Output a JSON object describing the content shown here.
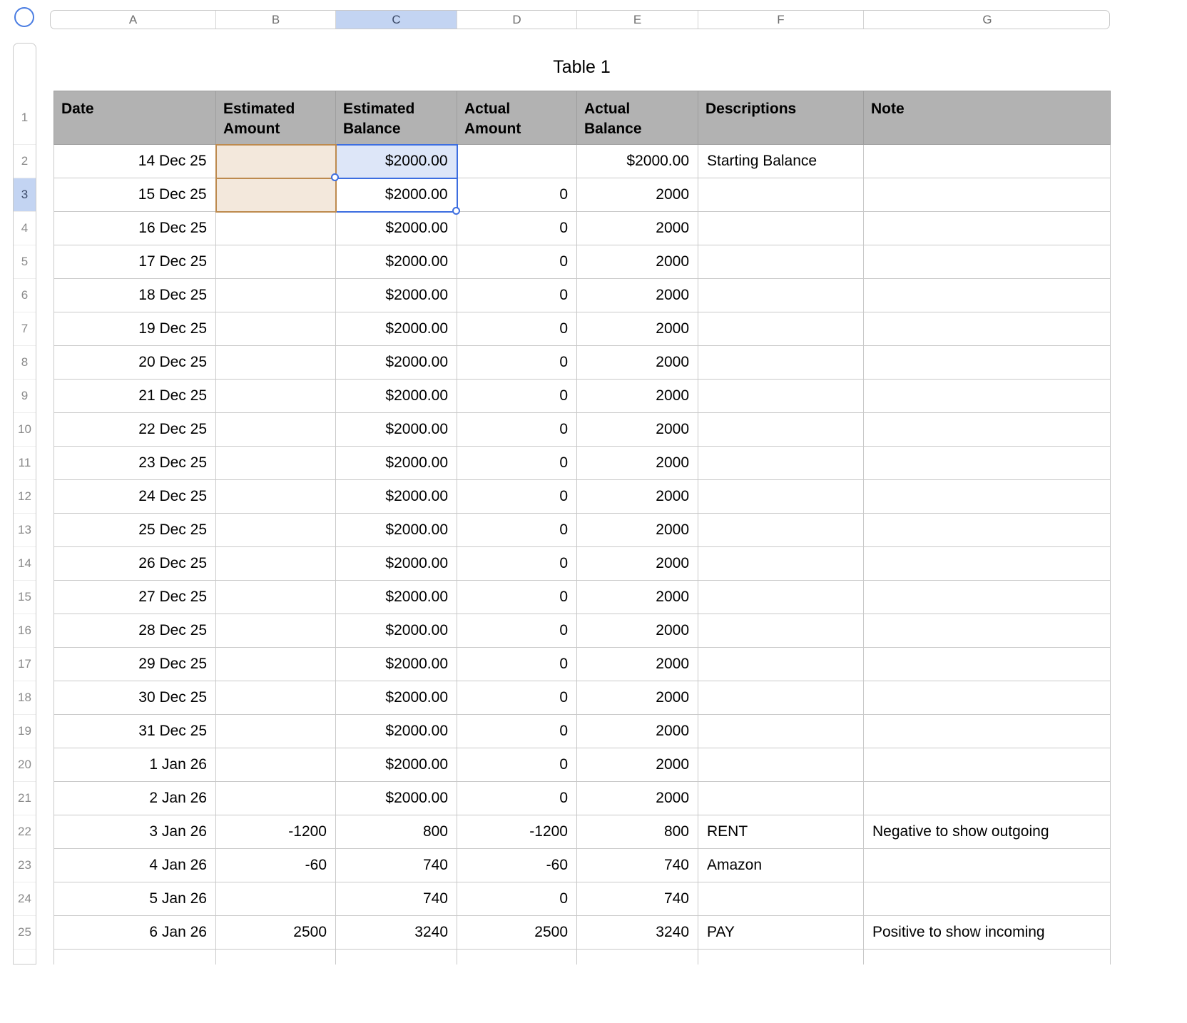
{
  "title": "Table 1",
  "column_strip": {
    "letters": [
      "A",
      "B",
      "C",
      "D",
      "E",
      "F",
      "G"
    ],
    "selected": "C"
  },
  "row_strip": {
    "numbers": [
      "1",
      "2",
      "3",
      "4",
      "5",
      "6",
      "7",
      "8",
      "9",
      "10",
      "11",
      "12",
      "13",
      "14",
      "15",
      "16",
      "17",
      "18",
      "19",
      "20",
      "21",
      "22",
      "23",
      "24",
      "25"
    ],
    "selected": "3"
  },
  "table": {
    "headers": [
      "Date",
      "Estimated Amount",
      "Estimated Balance",
      "Actual Amount",
      "Actual Balance",
      "Descriptions",
      "Note"
    ],
    "rows": [
      [
        "14 Dec 25",
        "",
        "$2000.00",
        "",
        "$2000.00",
        "Starting Balance",
        ""
      ],
      [
        "15 Dec 25",
        "",
        "$2000.00",
        "0",
        "2000",
        "",
        ""
      ],
      [
        "16 Dec 25",
        "",
        "$2000.00",
        "0",
        "2000",
        "",
        ""
      ],
      [
        "17 Dec 25",
        "",
        "$2000.00",
        "0",
        "2000",
        "",
        ""
      ],
      [
        "18 Dec 25",
        "",
        "$2000.00",
        "0",
        "2000",
        "",
        ""
      ],
      [
        "19 Dec 25",
        "",
        "$2000.00",
        "0",
        "2000",
        "",
        ""
      ],
      [
        "20 Dec 25",
        "",
        "$2000.00",
        "0",
        "2000",
        "",
        ""
      ],
      [
        "21 Dec 25",
        "",
        "$2000.00",
        "0",
        "2000",
        "",
        ""
      ],
      [
        "22 Dec 25",
        "",
        "$2000.00",
        "0",
        "2000",
        "",
        ""
      ],
      [
        "23 Dec 25",
        "",
        "$2000.00",
        "0",
        "2000",
        "",
        ""
      ],
      [
        "24 Dec 25",
        "",
        "$2000.00",
        "0",
        "2000",
        "",
        ""
      ],
      [
        "25 Dec 25",
        "",
        "$2000.00",
        "0",
        "2000",
        "",
        ""
      ],
      [
        "26 Dec 25",
        "",
        "$2000.00",
        "0",
        "2000",
        "",
        ""
      ],
      [
        "27 Dec 25",
        "",
        "$2000.00",
        "0",
        "2000",
        "",
        ""
      ],
      [
        "28 Dec 25",
        "",
        "$2000.00",
        "0",
        "2000",
        "",
        ""
      ],
      [
        "29 Dec 25",
        "",
        "$2000.00",
        "0",
        "2000",
        "",
        ""
      ],
      [
        "30 Dec 25",
        "",
        "$2000.00",
        "0",
        "2000",
        "",
        ""
      ],
      [
        "31 Dec 25",
        "",
        "$2000.00",
        "0",
        "2000",
        "",
        ""
      ],
      [
        "1 Jan 26",
        "",
        "$2000.00",
        "0",
        "2000",
        "",
        ""
      ],
      [
        "2 Jan 26",
        "",
        "$2000.00",
        "0",
        "2000",
        "",
        ""
      ],
      [
        "3 Jan 26",
        "-1200",
        "800",
        "-1200",
        "800",
        "RENT",
        "Negative to show outgoing"
      ],
      [
        "4 Jan 26",
        "-60",
        "740",
        "-60",
        "740",
        "Amazon",
        ""
      ],
      [
        "5 Jan 26",
        "",
        "740",
        "0",
        "740",
        "",
        ""
      ],
      [
        "6 Jan 26",
        "2500",
        "3240",
        "2500",
        "3240",
        "PAY",
        "Positive to show incoming"
      ]
    ]
  },
  "selection": {
    "referenced_cells": [
      "B2",
      "B3"
    ],
    "selected_cells": [
      {
        "cell": "C2",
        "style": "fill"
      },
      {
        "cell": "C3",
        "style": "open"
      }
    ],
    "active_column": "C",
    "active_row": "3"
  },
  "colors": {
    "selection_blue": "#3d6ee0",
    "reference_fill": "#f3e8dc",
    "reference_border": "#bd8a4e",
    "header_gray": "#b2b2b2",
    "selected_tab_blue": "#c3d4f2"
  }
}
